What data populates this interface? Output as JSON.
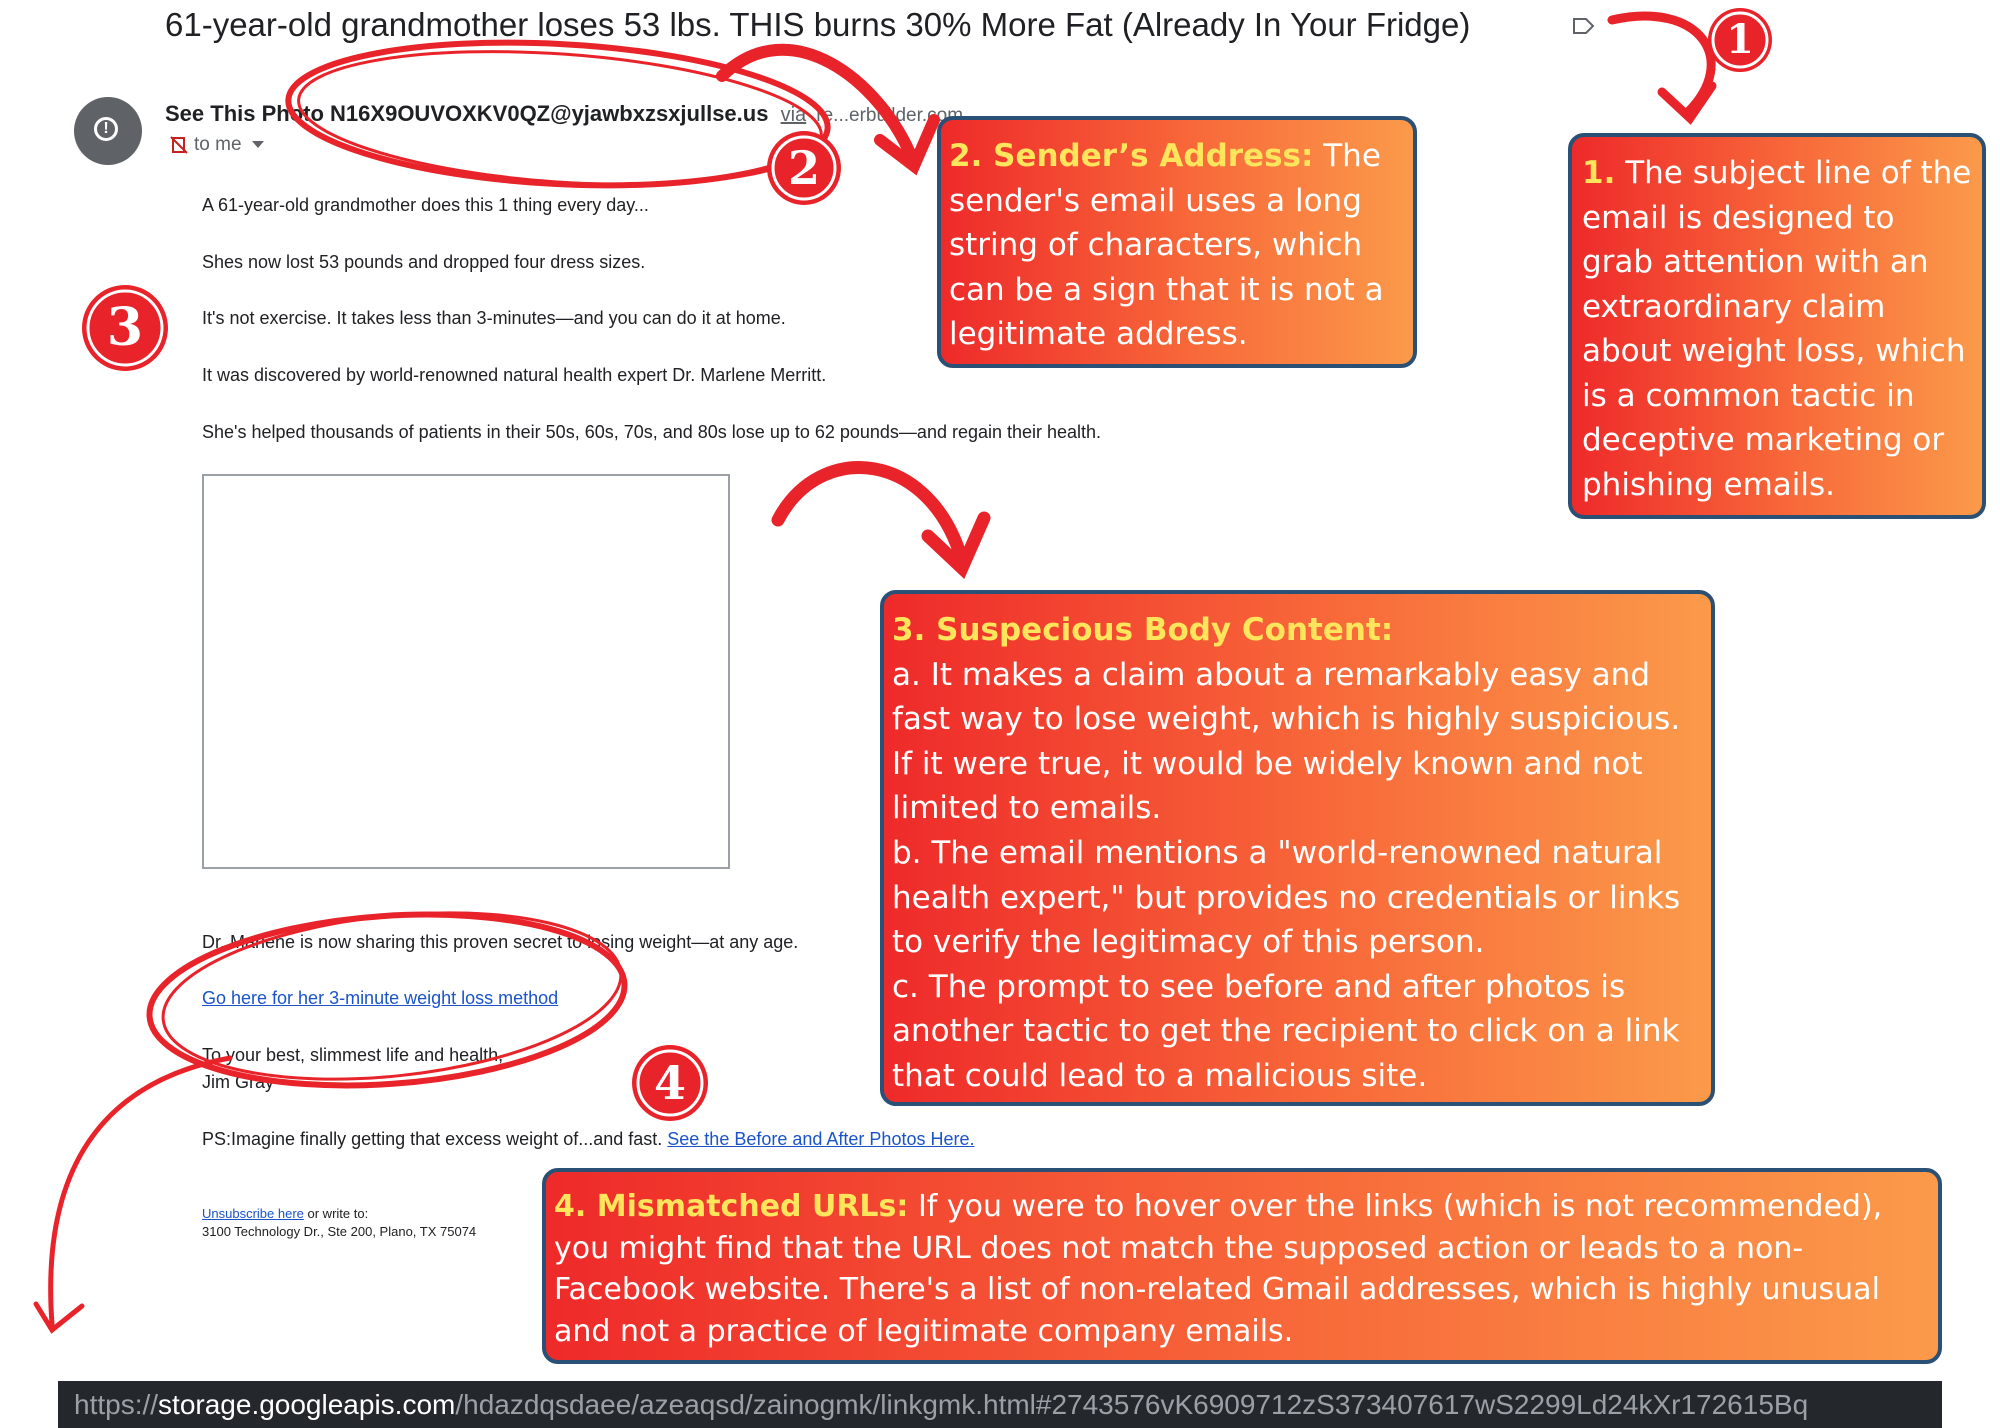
{
  "email": {
    "subject": "61-year-old grandmother loses 53 lbs. THIS burns 30% More Fat (Already In Your Fridge)",
    "sender_name": "See This Photo",
    "sender_email": "N16X9OUVOXKV0QZ@yjawbxzsxjullse.us",
    "sender_via": "via",
    "sender_relay": "re...erbuilder.com",
    "to_label": "to me",
    "body_lines": [
      "A 61-year-old grandmother does this 1 thing every day...",
      "Shes now lost 53 pounds and dropped four dress sizes.",
      "It's not exercise. It takes less than 3-minutes—and you can do it at home.",
      "It was discovered by world-renowned natural health expert Dr. Marlene Merritt.",
      "She's helped thousands of patients in their 50s, 60s, 70s, and 80s lose up to 62 pounds—and regain their health."
    ],
    "after_image_line": "Dr. Marlene is now sharing this proven secret to losing weight—at any age.",
    "cta_link": "Go here for her 3-minute weight loss method",
    "signoff": "To your best, slimmest life and health,",
    "signature": "Jim Gray",
    "ps_text": "PS:Imagine finally getting that excess weight of...and fast.",
    "ps_link": "See the Before and After Photos Here.",
    "unsubscribe_link": "Unsubscribe here",
    "unsubscribe_rest": "or write to:",
    "address": "3100 Technology Dr., Ste 200, Plano, TX 75074"
  },
  "callouts": {
    "c1": {
      "heading": "1.",
      "text": "The subject line of the email is designed to grab attention with an extraordinary claim about weight loss, which is a common tactic in deceptive marketing or phishing emails."
    },
    "c2": {
      "heading": "2. Sender’s Address:",
      "text": "The sender's email uses a long string of characters, which can be a sign that it is not a legitimate address."
    },
    "c3": {
      "heading": "3. Suspecious Body Content:",
      "a": "a. It makes a claim about a remarkably easy and fast way to lose weight, which is highly suspicious. If it were true, it would be widely known and not limited to emails.",
      "b": "b. The email mentions a \"world-renowned natural health expert,\" but provides no credentials or links to verify the legitimacy of this person.",
      "c": "c.  The prompt to see before and after photos is another tactic to get the recipient to click on a link that could lead to a malicious site."
    },
    "c4": {
      "heading": "4. Mismatched URLs:",
      "text": "If you were to hover over the links (which is not recommended), you might find that the URL does not match the supposed action or leads to a non-Facebook website. There's a list of non-related Gmail addresses, which is highly unusual and not a practice of legitimate company emails."
    }
  },
  "badges": [
    "1",
    "2",
    "3",
    "4"
  ],
  "url_bar": {
    "scheme": "https://",
    "host": "storage.googleapis.com",
    "path": "/hdazdqsdaee/azeaqsd/zainogmk/linkgmk.html#2743576vK6909712zS373407617wS2299Ld24kXr172615Bq"
  },
  "colors": {
    "annotation_red": "#e8232a",
    "callout_border": "#2b5076",
    "callout_heading": "#ffe55c",
    "link_blue": "#1a54c8"
  },
  "icons": [
    "label-icon",
    "alert-icon",
    "no-image-icon",
    "dropdown-caret-icon"
  ]
}
